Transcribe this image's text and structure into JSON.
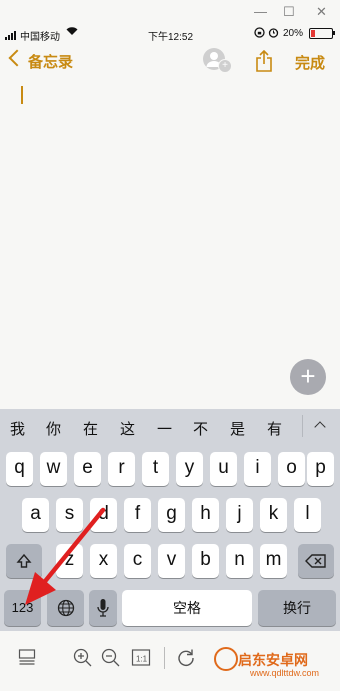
{
  "status_bar": {
    "carrier": "中国移动",
    "time": "下午12:52",
    "battery": "20%",
    "battery_color": "#e53935"
  },
  "nav": {
    "back_label": "备忘录",
    "done_label": "完成",
    "accent": "#c88a12"
  },
  "fab": {
    "label": "+"
  },
  "keyboard": {
    "candidates": [
      "我",
      "你",
      "在",
      "这",
      "一",
      "不",
      "是",
      "有"
    ],
    "row1": [
      "q",
      "w",
      "e",
      "r",
      "t",
      "y",
      "u",
      "i",
      "o",
      "p"
    ],
    "row2": [
      "a",
      "s",
      "d",
      "f",
      "g",
      "h",
      "j",
      "k",
      "l"
    ],
    "row3": [
      "z",
      "x",
      "c",
      "v",
      "b",
      "n",
      "m"
    ],
    "numbers_key": "123",
    "space_label": "空格",
    "return_label": "换行"
  },
  "watermark": {
    "brand": "启东安卓网",
    "url": "www.qdlttdw.com"
  }
}
